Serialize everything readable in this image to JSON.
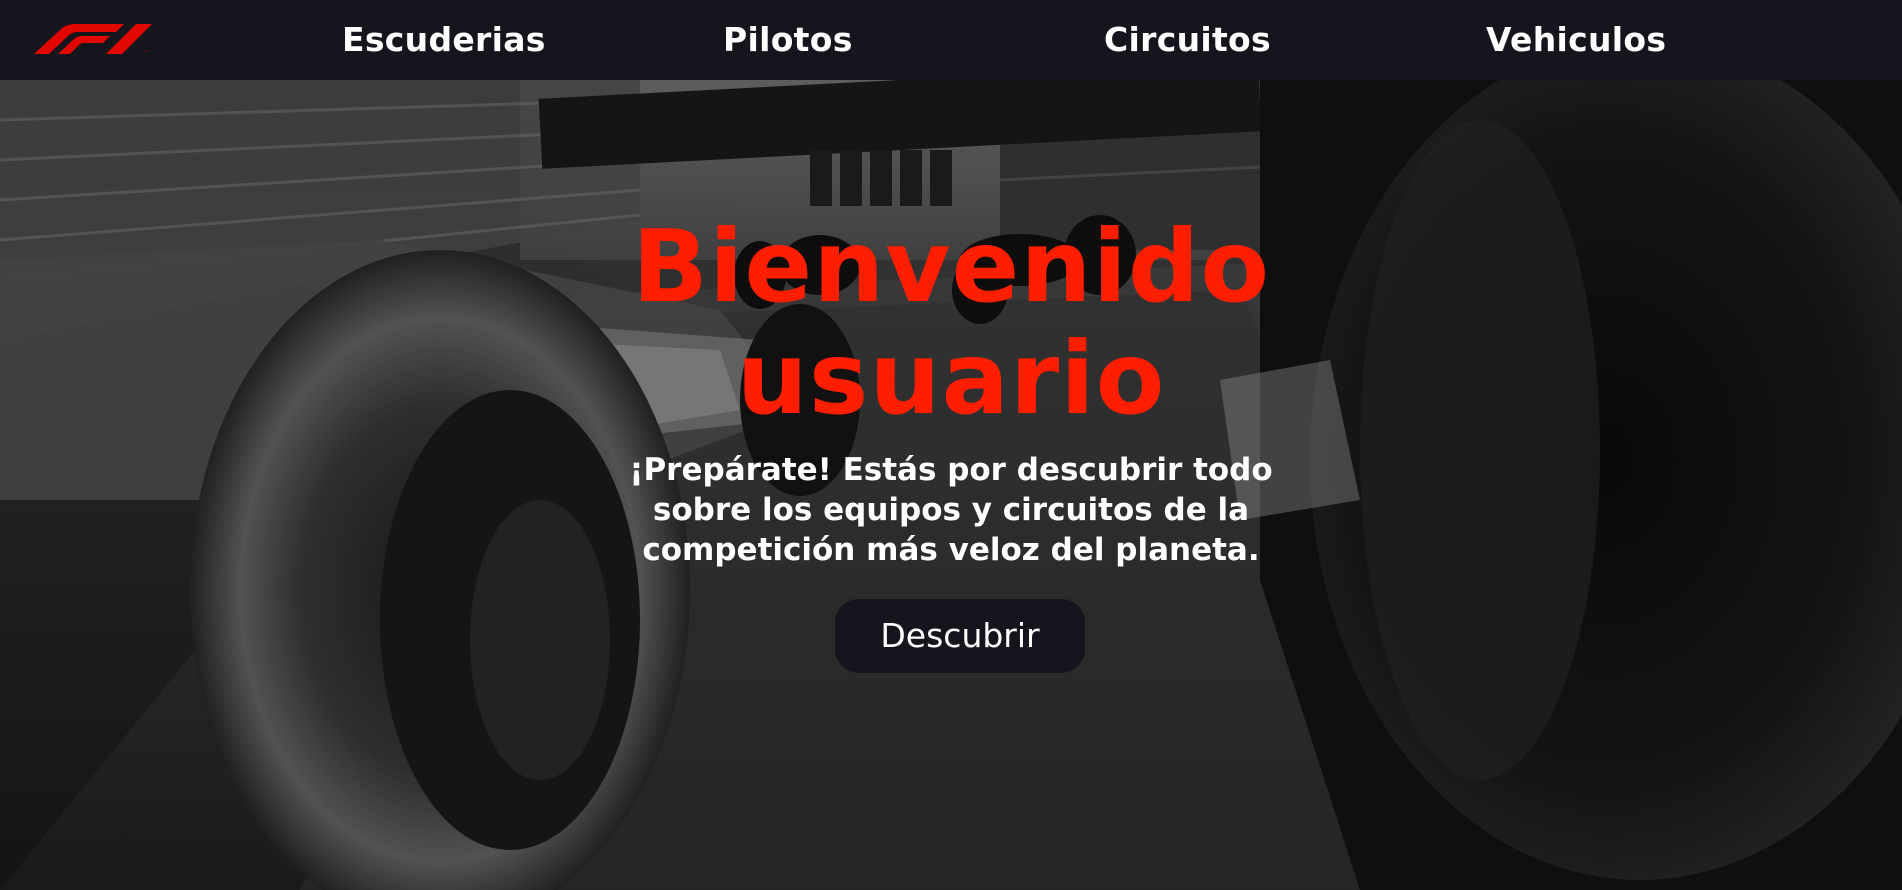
{
  "nav": {
    "logo": "F1",
    "links": [
      "Escuderias",
      "Pilotos",
      "Circuitos",
      "Vehiculos"
    ]
  },
  "hero": {
    "title_line1": "Bienvenido",
    "title_line2": "usuario",
    "subtitle": "¡Prepárate! Estás por descubrir todo sobre los equipos y circuitos de la competición más veloz del planeta.",
    "cta_label": "Descubrir"
  },
  "colors": {
    "accent": "#ff1e00",
    "nav_background": "#15151e",
    "text": "#ffffff"
  },
  "icons": {
    "logo": "f1-logo-icon"
  }
}
